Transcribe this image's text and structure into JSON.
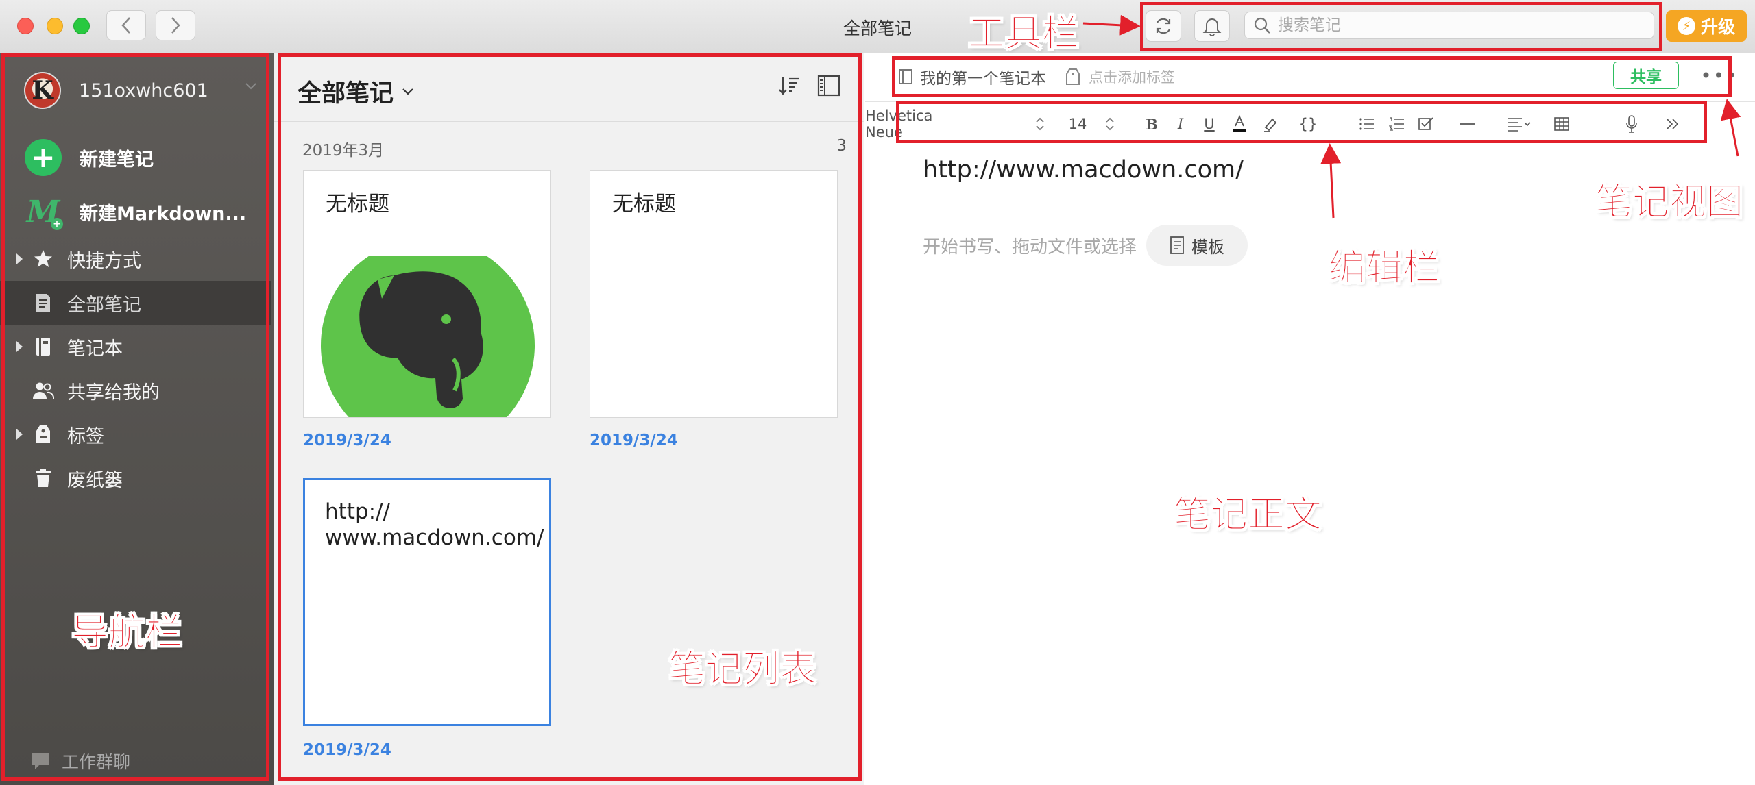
{
  "window": {
    "title": "全部笔记"
  },
  "toolbar": {
    "search_placeholder": "搜索笔记",
    "upgrade_label": "升级",
    "upgrade_color": "#f5a623"
  },
  "sidebar": {
    "account_name": "151oxwhc601",
    "new_note_label": "新建笔记",
    "new_markdown_label": "新建Markdown...",
    "items": [
      {
        "label": "快捷方式",
        "icon": "star-icon",
        "expandable": true,
        "active": false
      },
      {
        "label": "全部笔记",
        "icon": "note-icon",
        "expandable": false,
        "active": true
      },
      {
        "label": "笔记本",
        "icon": "notebook-icon",
        "expandable": true,
        "active": false
      },
      {
        "label": "共享给我的",
        "icon": "people-icon",
        "expandable": false,
        "active": false
      },
      {
        "label": "标签",
        "icon": "tag-icon",
        "expandable": true,
        "active": false
      },
      {
        "label": "废纸篓",
        "icon": "trash-icon",
        "expandable": false,
        "active": false
      }
    ],
    "footer_label": "工作群聊"
  },
  "notelist": {
    "title": "全部笔记",
    "month": "2019年3月",
    "count": "3",
    "notes": [
      {
        "title": "无标题",
        "date": "2019/3/24",
        "has_image": true,
        "selected": false
      },
      {
        "title": "无标题",
        "date": "2019/3/24",
        "has_image": false,
        "selected": false
      },
      {
        "title": "http://\nwww.macdown.com/",
        "date": "2019/3/24",
        "has_image": false,
        "selected": true
      }
    ]
  },
  "editor": {
    "notebook_name": "我的第一个笔记本",
    "tag_placeholder": "点击添加标签",
    "share_label": "共享",
    "font_name": "Helvetica Neue",
    "font_size": "14",
    "content_url": "http://www.macdown.com/",
    "body_placeholder": "开始书写、拖动文件或选择",
    "template_label": "模板"
  },
  "annotations": {
    "toolbar": "工具栏",
    "nav": "导航栏",
    "note_list": "笔记列表",
    "edit_bar": "编辑栏",
    "note_view": "笔记视图",
    "note_body": "笔记正文",
    "color": "#e2202b"
  },
  "colors": {
    "accent_green": "#2dbe60",
    "link_blue": "#3b82e0",
    "sidebar_bg": "#57544f"
  }
}
